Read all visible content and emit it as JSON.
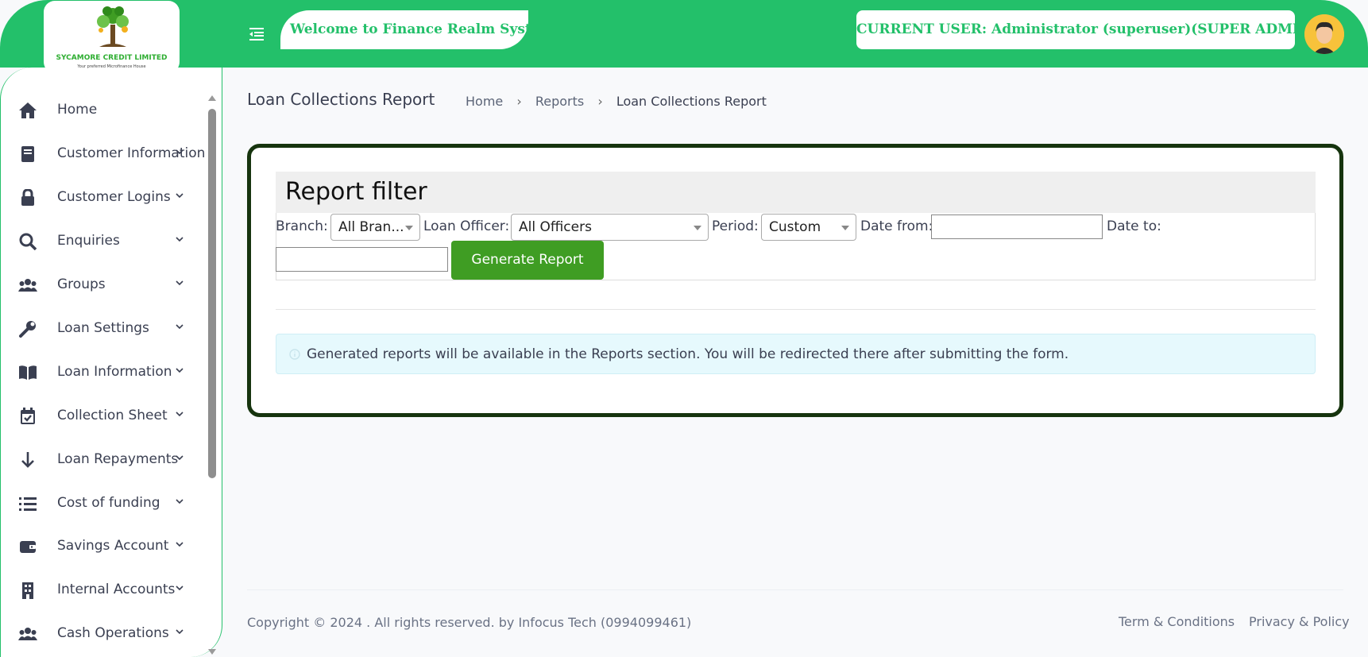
{
  "header": {
    "logo_name": "SYCAMORE CREDIT LIMITED",
    "logo_tagline": "Your preferred Microfinance House",
    "welcome": "Welcome to Finance Realm System",
    "current_user": "CURRENT USER: Administrator (superuser)(SUPER ADMIN)",
    "brand_color": "#23c06a"
  },
  "sidebar": {
    "items": [
      {
        "label": "Home",
        "icon": "home-icon",
        "has_submenu": false
      },
      {
        "label": "Customer Information",
        "icon": "book-icon",
        "has_submenu": true
      },
      {
        "label": "Customer Logins",
        "icon": "lock-icon",
        "has_submenu": true
      },
      {
        "label": "Enquiries",
        "icon": "search-icon",
        "has_submenu": true
      },
      {
        "label": "Groups",
        "icon": "users-icon",
        "has_submenu": true
      },
      {
        "label": "Loan Settings",
        "icon": "wrench-icon",
        "has_submenu": true
      },
      {
        "label": "Loan Information",
        "icon": "open-book-icon",
        "has_submenu": true
      },
      {
        "label": "Collection Sheet",
        "icon": "calendar-check-icon",
        "has_submenu": true
      },
      {
        "label": "Loan Repayments",
        "icon": "arrow-down-icon",
        "has_submenu": true
      },
      {
        "label": "Cost of funding",
        "icon": "list-icon",
        "has_submenu": true
      },
      {
        "label": "Savings Account",
        "icon": "wallet-icon",
        "has_submenu": true
      },
      {
        "label": "Internal Accounts",
        "icon": "building-icon",
        "has_submenu": true
      },
      {
        "label": "Cash Operations",
        "icon": "users-icon",
        "has_submenu": true
      }
    ]
  },
  "page": {
    "title": "Loan Collections Report",
    "breadcrumb": {
      "home": "Home",
      "reports": "Reports",
      "current": "Loan Collections Report"
    }
  },
  "filter": {
    "heading": "Report filter",
    "branch_label": "Branch:",
    "branch_value": "All Bran...",
    "officer_label": "Loan Officer:",
    "officer_value": "All Officers",
    "period_label": "Period:",
    "period_value": "Custom",
    "date_from_label": "Date from:",
    "date_from_value": "",
    "date_to_label": "Date to:",
    "date_to_value": "",
    "generate_label": "Generate Report"
  },
  "alert": {
    "text": "Generated reports will be available in the Reports section. You will be redirected there after submitting the form."
  },
  "footer": {
    "copyright": "Copyright © 2024 . All rights reserved. by Infocus Tech (0994099461)",
    "terms": "Term & Conditions",
    "privacy": "Privacy & Policy"
  }
}
